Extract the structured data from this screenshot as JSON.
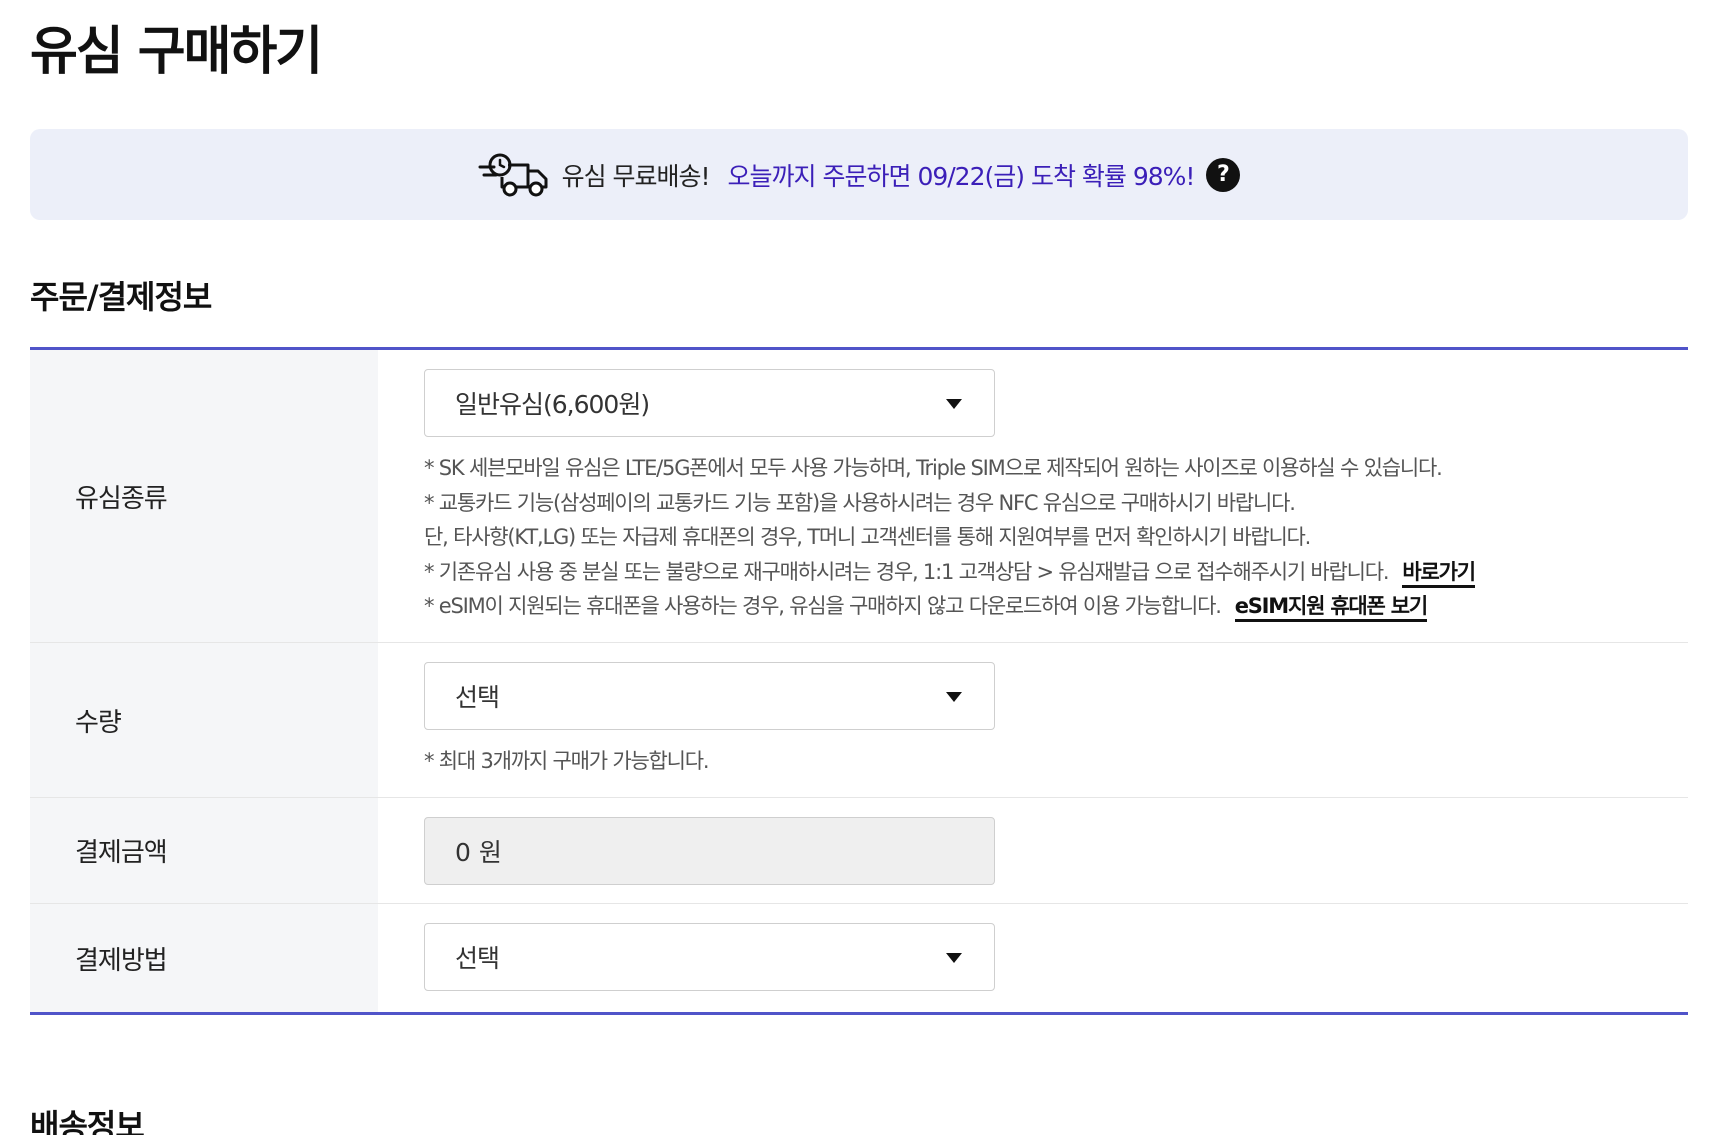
{
  "page": {
    "title": "유심 구매하기"
  },
  "banner": {
    "icon": "delivery-truck-icon",
    "prefix": "유심 무료배송!",
    "text": "오늘까지 주문하면 09/22(금) 도착 확률 98%!",
    "help_icon": "?"
  },
  "order_section": {
    "title": "주문/결제정보",
    "rows": {
      "sim_type": {
        "label": "유심종류",
        "selected": "일반유심(6,600원)",
        "notes": [
          "* SK 세븐모바일 유심은 LTE/5G폰에서 모두 사용 가능하며, Triple SIM으로 제작되어 원하는 사이즈로 이용하실 수 있습니다.",
          "* 교통카드 기능(삼성페이의 교통카드 기능 포함)을 사용하시려는 경우 NFC 유심으로 구매하시기 바랍니다.",
          "단, 타사향(KT,LG) 또는 자급제 휴대폰의 경우, T머니 고객센터를 통해 지원여부를 먼저 확인하시기 바랍니다.",
          "* 기존유심 사용 중 분실 또는 불량으로 재구매하시려는 경우, 1:1 고객상담 > 유심재발급 으로 접수해주시기 바랍니다.",
          "* eSIM이 지원되는 휴대폰을 사용하는 경우, 유심을 구매하지 않고 다운로드하여 이용 가능합니다."
        ],
        "link_shortcut": "바로가기",
        "link_esim": "eSIM지원 휴대폰 보기"
      },
      "quantity": {
        "label": "수량",
        "selected": "선택",
        "note": "* 최대 3개까지 구매가 가능합니다."
      },
      "amount": {
        "label": "결제금액",
        "value": "0 원"
      },
      "payment": {
        "label": "결제방법",
        "selected": "선택"
      }
    }
  },
  "delivery_section": {
    "title": "배송정보"
  },
  "colors": {
    "accent": "#5054c9",
    "banner_bg": "#eceff9",
    "banner_text": "#3b1fb8",
    "label_bg": "#f5f6f8"
  }
}
